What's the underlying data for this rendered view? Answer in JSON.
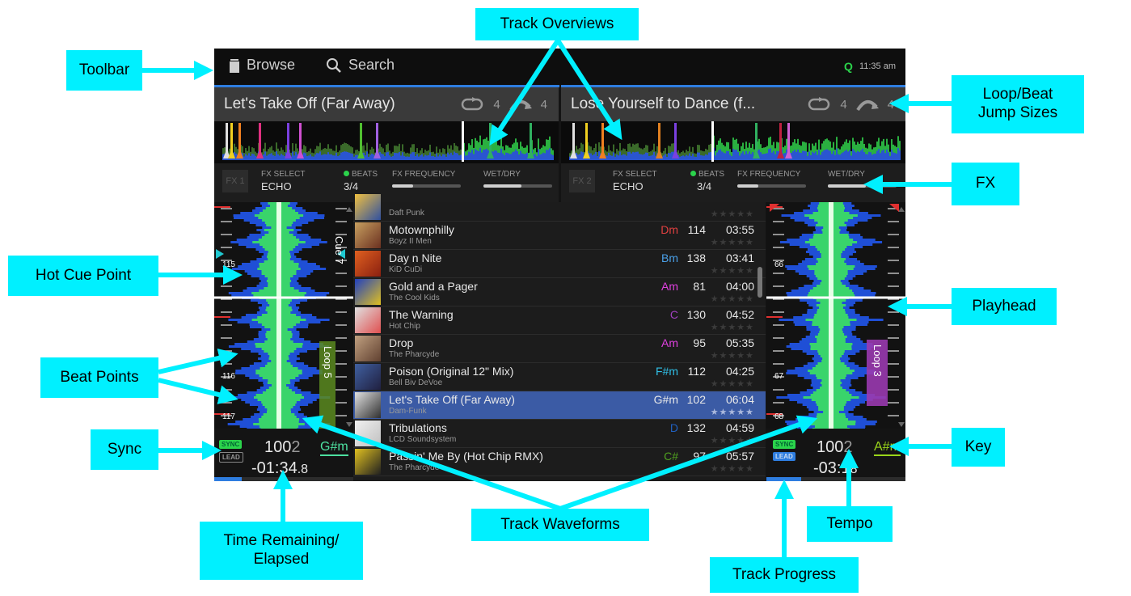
{
  "toolbar": {
    "browse": "Browse",
    "search": "Search",
    "q": "Q",
    "time": "11:35 am"
  },
  "decks": [
    {
      "title": "Let's Take Off (Far Away)",
      "loop_size": "4",
      "jump_size": "4",
      "fx_slot": "FX 1",
      "fx_select_label": "FX SELECT",
      "fx_name": "ECHO",
      "beats_label": "BEATS",
      "beats": "3/4",
      "fx_freq_label": "FX FREQUENCY",
      "wetdry_label": "WET/DRY",
      "freq_level": 0.3,
      "wetdry_level": 0.55,
      "cue_label": "Cue 7",
      "loop_label": "Loop 5",
      "beat_nums": [
        "115",
        "116",
        "117"
      ],
      "sync": "SYNC",
      "lead": "LEAD",
      "tempo_main": "100",
      "tempo_dec": "2",
      "key": "G#m",
      "key_color": "#4de0a0",
      "time_main": "-01:34",
      "time_dec": ".8",
      "progress": 0.2
    },
    {
      "title": "Lose Yourself to Dance (f...",
      "loop_size": "4",
      "jump_size": "4",
      "fx_slot": "FX 2",
      "fx_select_label": "FX SELECT",
      "fx_name": "ECHO",
      "beats_label": "BEATS",
      "beats": "3/4",
      "fx_freq_label": "FX FREQUENCY",
      "wetdry_label": "WET/DRY",
      "freq_level": 0.3,
      "wetdry_level": 0.55,
      "loop_label": "Loop 3",
      "beat_nums": [
        "66",
        "67",
        "68"
      ],
      "sync": "SYNC",
      "lead": "LEAD",
      "tempo_main": "100",
      "tempo_dec": "2",
      "key": "A#m",
      "key_color": "#9ad51a",
      "time_main": "-03:1",
      "time_dec": "8",
      "progress": 0.25
    }
  ],
  "library": [
    {
      "name": "",
      "artist": "Daft Punk",
      "key": "",
      "key_color": "#888",
      "bpm": "",
      "time": "",
      "stars": "★★★★★",
      "art": [
        "#f0c040",
        "#3050a0"
      ]
    },
    {
      "name": "Motownphilly",
      "artist": "Boyz II Men",
      "key": "Dm",
      "key_color": "#e04040",
      "bpm": "114",
      "time": "03:55",
      "stars": "★★★★★",
      "art": [
        "#c8a060",
        "#6a3020"
      ]
    },
    {
      "name": "Day n Nite",
      "artist": "KiD CuDi",
      "key": "Bm",
      "key_color": "#4aa0e8",
      "bpm": "138",
      "time": "03:41",
      "stars": "★★★★★",
      "art": [
        "#e06020",
        "#8a2010"
      ]
    },
    {
      "name": "Gold and a Pager",
      "artist": "The Cool Kids",
      "key": "Am",
      "key_color": "#e040e0",
      "bpm": "81",
      "time": "04:00",
      "stars": "★★★★★",
      "art": [
        "#2040c0",
        "#e0c020"
      ]
    },
    {
      "name": "The Warning",
      "artist": "Hot Chip",
      "key": "C",
      "key_color": "#a040c0",
      "bpm": "130",
      "time": "04:52",
      "stars": "★★★★★",
      "art": [
        "#e0e0e0",
        "#e05050"
      ]
    },
    {
      "name": "Drop",
      "artist": "The Pharcyde",
      "key": "Am",
      "key_color": "#e040e0",
      "bpm": "95",
      "time": "05:35",
      "stars": "★★★★★",
      "art": [
        "#c0a080",
        "#604030"
      ]
    },
    {
      "name": "Poison (Original 12\" Mix)",
      "artist": "Bell Biv DeVoe",
      "key": "F#m",
      "key_color": "#30c0e8",
      "bpm": "112",
      "time": "04:25",
      "stars": "★★★★★",
      "art": [
        "#4060a0",
        "#202040"
      ]
    },
    {
      "name": "Let's Take Off (Far Away)",
      "artist": "Dam-Funk",
      "key": "G#m",
      "key_color": "#e8e8e8",
      "bpm": "102",
      "time": "06:04",
      "stars": "★★★★★",
      "art": [
        "#e0e0e0",
        "#303030"
      ],
      "selected": true
    },
    {
      "name": "Tribulations",
      "artist": "LCD Soundsystem",
      "key": "D",
      "key_color": "#2060c0",
      "bpm": "132",
      "time": "04:59",
      "stars": "★★★★★",
      "art": [
        "#f0f0f0",
        "#c0c0c0"
      ]
    },
    {
      "name": "Passin' Me By (Hot Chip RMX)",
      "artist": "The Pharcyde",
      "key": "C#",
      "key_color": "#50a020",
      "bpm": "97",
      "time": "05:57",
      "stars": "★★★★★",
      "art": [
        "#e0c020",
        "#202020"
      ]
    }
  ],
  "callouts": {
    "toolbar": "Toolbar",
    "track_overviews": "Track Overviews",
    "loop_beat": "Loop/Beat Jump Sizes",
    "fx": "FX",
    "hot_cue": "Hot Cue Point",
    "playhead": "Playhead",
    "beat_points": "Beat Points",
    "sync": "Sync",
    "key": "Key",
    "time_remaining": "Time Remaining/ Elapsed",
    "track_waveforms": "Track Waveforms",
    "tempo": "Tempo",
    "track_progress": "Track Progress"
  }
}
